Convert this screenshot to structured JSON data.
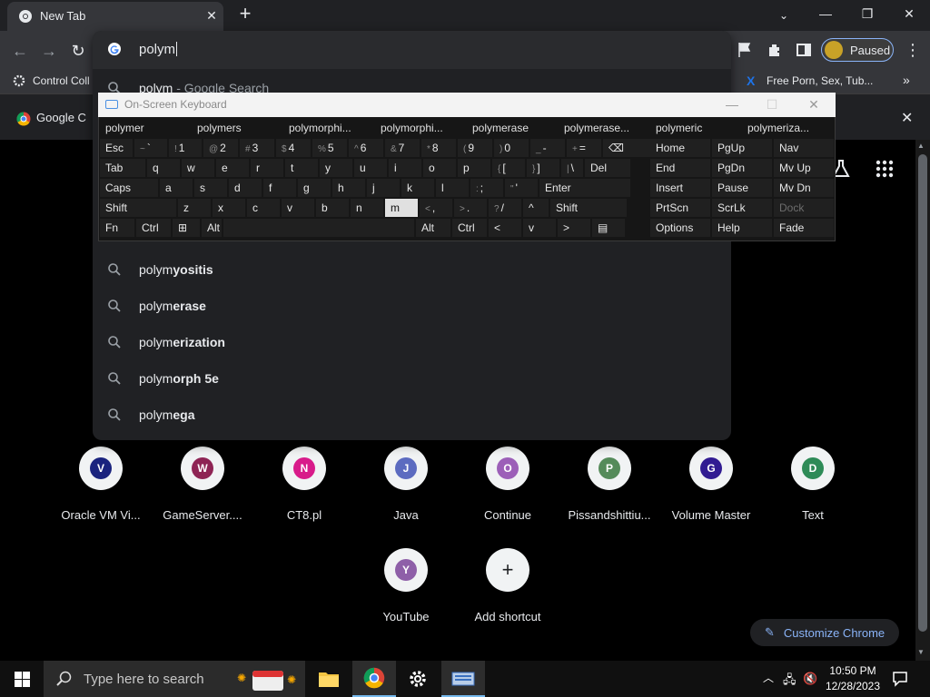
{
  "browser": {
    "tab": {
      "title": "New Tab"
    },
    "profile": {
      "label": "Paused"
    },
    "bookmarks": [
      {
        "label": "Control Coll"
      },
      {
        "label": "Google C"
      },
      {
        "label": "Free Porn, Sex, Tub..."
      }
    ]
  },
  "omnibox": {
    "text": "polym",
    "suggestions": [
      {
        "typed": "polym",
        "rest": "",
        "suffix": " - Google Search"
      },
      {
        "typed": "polym",
        "rest": "yositis"
      },
      {
        "typed": "polym",
        "rest": "erase"
      },
      {
        "typed": "polym",
        "rest": "erization"
      },
      {
        "typed": "polym",
        "rest": "orph 5e"
      },
      {
        "typed": "polym",
        "rest": "ega"
      }
    ]
  },
  "osk": {
    "title": "On-Screen Keyboard",
    "predictions": [
      "polymer",
      "polymers",
      "polymorphi...",
      "polymorphi...",
      "polymerase",
      "polymerase...",
      "polymeric",
      "polymeriza..."
    ],
    "row1": [
      {
        "main": "Esc"
      },
      {
        "sub": "~",
        "main": "`"
      },
      {
        "sub": "!",
        "main": "1"
      },
      {
        "sub": "@",
        "main": "2"
      },
      {
        "sub": "#",
        "main": "3"
      },
      {
        "sub": "$",
        "main": "4"
      },
      {
        "sub": "%",
        "main": "5"
      },
      {
        "sub": "^",
        "main": "6"
      },
      {
        "sub": "&",
        "main": "7"
      },
      {
        "sub": "*",
        "main": "8"
      },
      {
        "sub": "(",
        "main": "9"
      },
      {
        "sub": ")",
        "main": "0"
      },
      {
        "sub": "_",
        "main": "-"
      },
      {
        "sub": "+",
        "main": "="
      },
      {
        "main": "⌫"
      }
    ],
    "row2": [
      "Tab",
      "q",
      "w",
      "e",
      "r",
      "t",
      "y",
      "u",
      "i",
      "o",
      "p",
      "[",
      "]",
      "\\",
      "Del"
    ],
    "row2sub": [
      "",
      "",
      "",
      "",
      "",
      "",
      "",
      "",
      "",
      "",
      "",
      "{",
      "}",
      "|",
      ""
    ],
    "row3": [
      "Caps",
      "a",
      "s",
      "d",
      "f",
      "g",
      "h",
      "j",
      "k",
      "l",
      ";",
      "'",
      "Enter"
    ],
    "row3sub": [
      "",
      "",
      "",
      "",
      "",
      "",
      "",
      "",
      "",
      "",
      ":",
      "\"",
      ""
    ],
    "row4": [
      "Shift",
      "z",
      "x",
      "c",
      "v",
      "b",
      "n",
      "m",
      ",",
      ".",
      "/",
      "^",
      "Shift"
    ],
    "row4sub": [
      "",
      "",
      "",
      "",
      "",
      "",
      "",
      "",
      "<",
      ">",
      "?",
      "",
      ""
    ],
    "row5": [
      "Fn",
      "Ctrl",
      "⊞",
      "Alt",
      "",
      "Alt",
      "Ctrl",
      "<",
      "v",
      ">",
      "▤"
    ],
    "nav": [
      [
        "Home",
        "PgUp",
        "Nav"
      ],
      [
        "End",
        "PgDn",
        "Mv Up"
      ],
      [
        "Insert",
        "Pause",
        "Mv Dn"
      ],
      [
        "PrtScn",
        "ScrLk",
        "Dock"
      ],
      [
        "Options",
        "Help",
        "Fade"
      ]
    ]
  },
  "shortcuts": [
    {
      "letter": "V",
      "label": "Oracle VM Vi...",
      "color": "#1a237e"
    },
    {
      "letter": "W",
      "label": "GameServer....",
      "color": "#8e2454"
    },
    {
      "letter": "N",
      "label": "CT8.pl",
      "color": "#d81b8a"
    },
    {
      "letter": "J",
      "label": "Java",
      "color": "#5c6bc0"
    },
    {
      "letter": "O",
      "label": "Continue",
      "color": "#9c5fb8"
    },
    {
      "letter": "P",
      "label": "Pissandshittiu...",
      "color": "#558b5a"
    },
    {
      "letter": "G",
      "label": "Volume Master",
      "color": "#311b92"
    },
    {
      "letter": "D",
      "label": "Text",
      "color": "#2e8b57"
    },
    {
      "letter": "Y",
      "label": "YouTube",
      "color": "#8e5fa8"
    },
    {
      "letter": "+",
      "label": "Add shortcut",
      "color": "#f1f3f4"
    }
  ],
  "customize": {
    "label": "Customize Chrome"
  },
  "taskbar": {
    "search_placeholder": "Type here to search",
    "time": "10:50 PM",
    "date": "12/28/2023"
  },
  "colors": {
    "accent": "#8ab4f8",
    "tab_bg": "#35363a",
    "strip_bg": "#202124"
  }
}
